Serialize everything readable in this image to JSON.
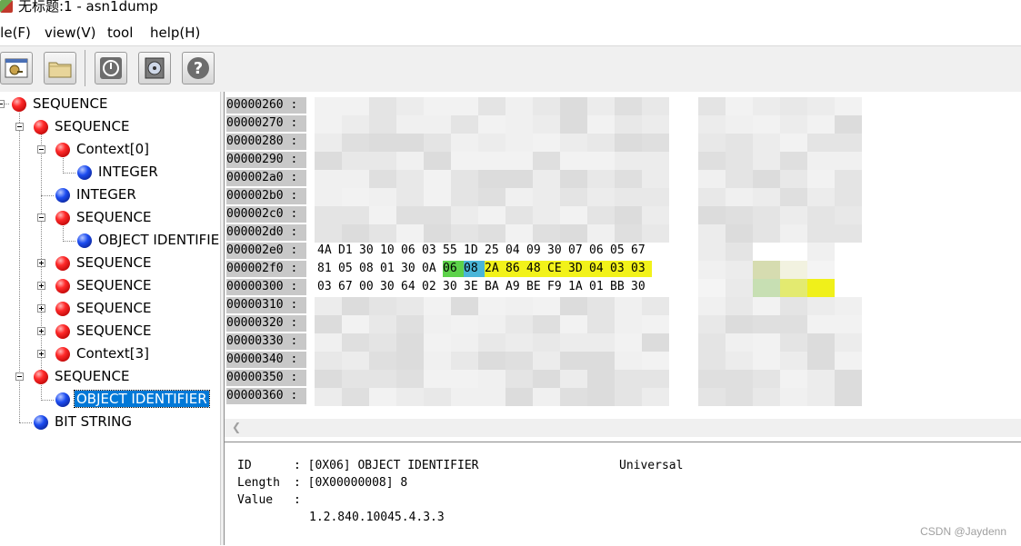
{
  "window": {
    "title": "无标题:1 - asn1dump"
  },
  "menu": [
    "ile(F)",
    "view(V)",
    "tool",
    "help(H)"
  ],
  "toolbar": {
    "buttons": [
      "open-viewer-icon",
      "folder-icon",
      "power-icon",
      "disk-icon",
      "help-icon"
    ]
  },
  "tree": {
    "nodes": [
      {
        "label": "SEQUENCE",
        "color": "red"
      },
      {
        "label": "SEQUENCE",
        "color": "red"
      },
      {
        "label": "Context[0]",
        "color": "red"
      },
      {
        "label": "INTEGER",
        "color": "blue"
      },
      {
        "label": "INTEGER",
        "color": "blue"
      },
      {
        "label": "SEQUENCE",
        "color": "red"
      },
      {
        "label": "OBJECT IDENTIFIE",
        "color": "blue"
      },
      {
        "label": "SEQUENCE",
        "color": "red"
      },
      {
        "label": "SEQUENCE",
        "color": "red"
      },
      {
        "label": "SEQUENCE",
        "color": "red"
      },
      {
        "label": "SEQUENCE",
        "color": "red"
      },
      {
        "label": "Context[3]",
        "color": "red"
      },
      {
        "label": "SEQUENCE",
        "color": "red"
      },
      {
        "label": "OBJECT IDENTIFIER",
        "color": "blue",
        "selected": true
      },
      {
        "label": "BIT STRING",
        "color": "blue"
      }
    ]
  },
  "hex": {
    "addresses": [
      "00000260 :",
      "00000270 :",
      "00000280 :",
      "00000290 :",
      "000002a0 :",
      "000002b0 :",
      "000002c0 :",
      "000002d0 :",
      "000002e0 :",
      "000002f0 :",
      "00000300 :",
      "00000310 :",
      "00000320 :",
      "00000330 :",
      "00000340 :",
      "00000350 :",
      "00000360 :"
    ],
    "visible_rows": [
      {
        "bytes": [
          "4A",
          "D1",
          "30",
          "10",
          "06",
          "03",
          "55",
          "1D",
          "25",
          "04",
          "09",
          "30",
          "07",
          "06",
          "05",
          "67"
        ],
        "hl": [
          "",
          "",
          "",
          "",
          "",
          "",
          "",
          "",
          "",
          "",
          "",
          "",
          "",
          "",
          "",
          ""
        ]
      },
      {
        "bytes": [
          "81",
          "05",
          "08",
          "01",
          "30",
          "0A",
          "06",
          "08",
          "2A",
          "86",
          "48",
          "CE",
          "3D",
          "04",
          "03",
          "03"
        ],
        "hl": [
          "",
          "",
          "",
          "",
          "",
          "",
          "g",
          "b",
          "y",
          "y",
          "y",
          "y",
          "y",
          "y",
          "y",
          "y"
        ]
      },
      {
        "bytes": [
          "03",
          "67",
          "00",
          "30",
          "64",
          "02",
          "30",
          "3E",
          "BA",
          "A9",
          "BE",
          "F9",
          "1A",
          "01",
          "BB",
          "30"
        ],
        "hl": [
          "",
          "",
          "",
          "",
          "",
          "",
          "",
          "",
          "",
          "",
          "",
          "",
          "",
          "",
          "",
          ""
        ]
      }
    ]
  },
  "info": {
    "id_label": "ID",
    "id_value": ": [0X06] OBJECT IDENTIFIER",
    "class": "Universal",
    "length_label": "Length",
    "length_value": ": [0X00000008] 8",
    "value_label": "Value",
    "value_colon": ":",
    "value": "1.2.840.10045.4.3.3"
  },
  "watermark": "CSDN @Jaydenn",
  "colors": {
    "highlight_green": "#5dd24a",
    "highlight_blue": "#4ab5d8",
    "highlight_yellow": "#f2f21a",
    "selection": "#0078d7"
  }
}
